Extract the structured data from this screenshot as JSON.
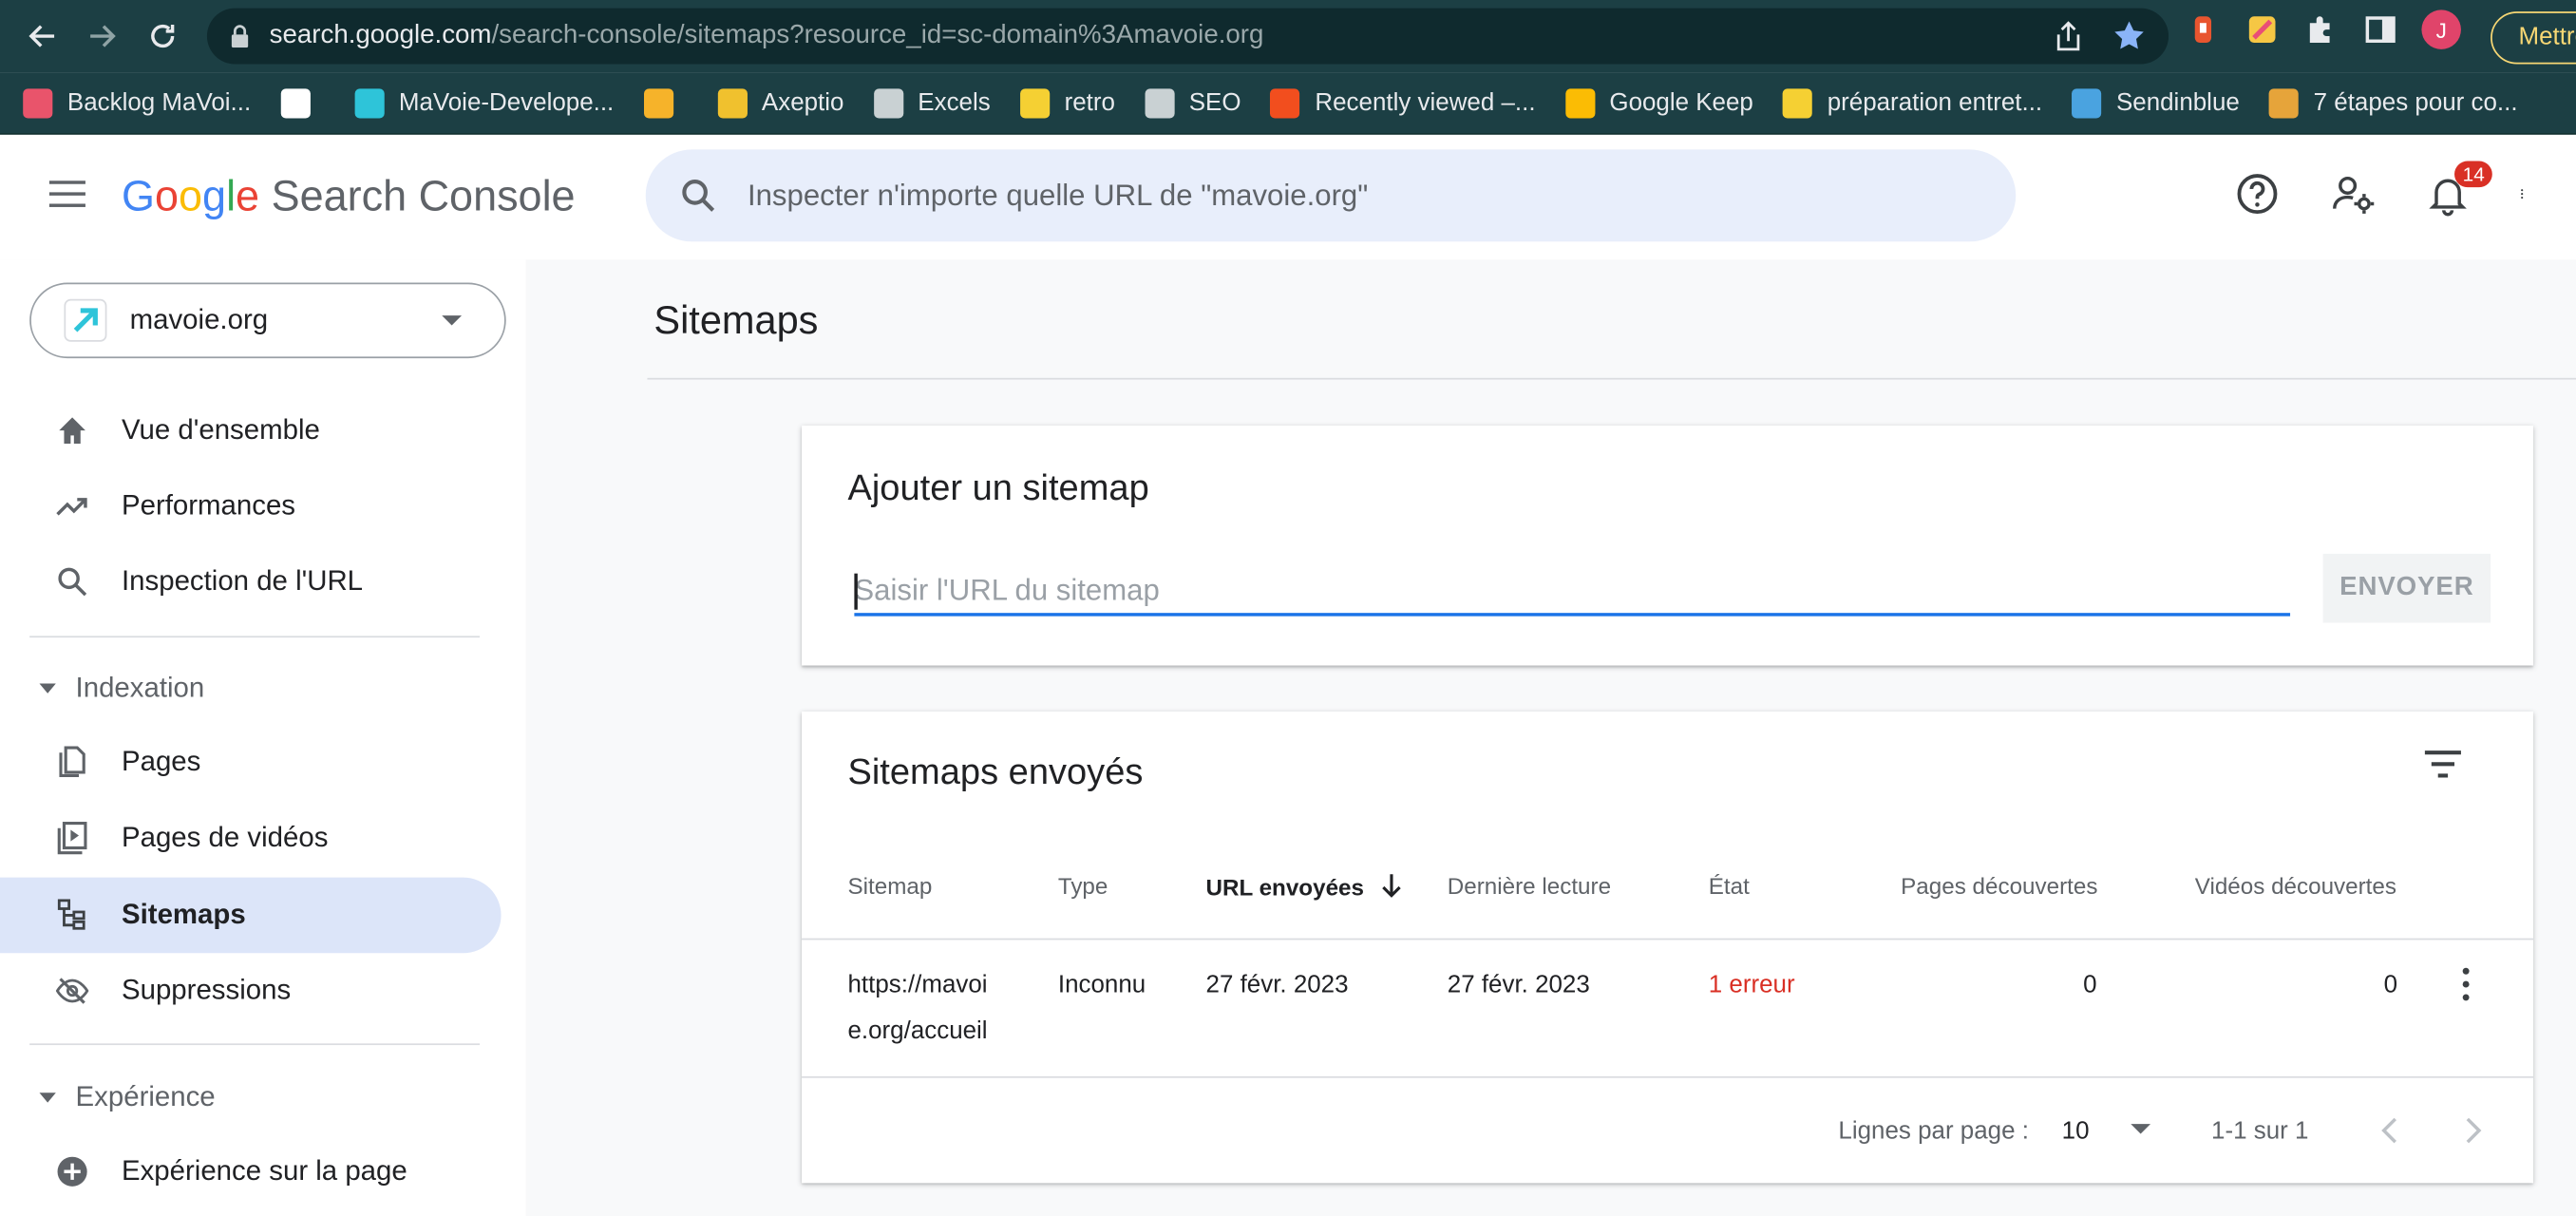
{
  "browser": {
    "url_host": "search.google.com",
    "url_path": "/search-console/sitemaps?resource_id=sc-domain%3Amavoie.org",
    "avatar_letter": "J",
    "update_button": "Mettre",
    "bookmarks": [
      {
        "label": "Backlog MaVoi...",
        "icon": "trello-icon",
        "color": "#e9546b"
      },
      {
        "label": "",
        "icon": "github-icon",
        "color": "#ffffff"
      },
      {
        "label": "MaVoie-Develope...",
        "icon": "arrow-icon",
        "color": "#2ec4d9"
      },
      {
        "label": "",
        "icon": "firebase-icon",
        "color": "#f6b32a"
      },
      {
        "label": "Axeptio",
        "icon": "axeptio-icon",
        "color": "#f0c12e"
      },
      {
        "label": "Excels",
        "icon": "folder-icon",
        "color": "#c9d1d3"
      },
      {
        "label": "retro",
        "icon": "miro-icon",
        "color": "#f5d033"
      },
      {
        "label": "SEO",
        "icon": "folder-icon",
        "color": "#c9d1d3"
      },
      {
        "label": "Recently viewed –...",
        "icon": "figma-icon",
        "color": "#f24e1e"
      },
      {
        "label": "Google Keep",
        "icon": "keep-icon",
        "color": "#fbbc04"
      },
      {
        "label": "préparation entret...",
        "icon": "miro-icon",
        "color": "#f5d033"
      },
      {
        "label": "Sendinblue",
        "icon": "sendinblue-icon",
        "color": "#4aa3e0"
      },
      {
        "label": "7 étapes pour co...",
        "icon": "profile-icon",
        "color": "#e6a43a"
      }
    ]
  },
  "header": {
    "brand_google": [
      "G",
      "o",
      "o",
      "g",
      "l",
      "e"
    ],
    "brand_product": "Search Console",
    "search_placeholder": "Inspecter n'importe quelle URL de \"mavoie.org\"",
    "notification_count": "14"
  },
  "sidebar": {
    "property": "mavoie.org",
    "items_top": [
      {
        "label": "Vue d'ensemble",
        "icon": "home-icon"
      },
      {
        "label": "Performances",
        "icon": "trending-up-icon"
      },
      {
        "label": "Inspection de l'URL",
        "icon": "search-icon"
      }
    ],
    "section_indexation": "Indexation",
    "items_indexation": [
      {
        "label": "Pages",
        "icon": "pages-icon"
      },
      {
        "label": "Pages de vidéos",
        "icon": "video-pages-icon"
      },
      {
        "label": "Sitemaps",
        "icon": "sitemap-icon",
        "active": true
      },
      {
        "label": "Suppressions",
        "icon": "eye-off-icon"
      }
    ],
    "section_experience": "Expérience",
    "items_experience": [
      {
        "label": "Expérience sur la page",
        "icon": "plus-circle-icon"
      }
    ]
  },
  "main": {
    "page_title": "Sitemaps",
    "add_card": {
      "title": "Ajouter un sitemap",
      "input_placeholder": "Saisir l'URL du sitemap",
      "input_value": "",
      "submit_label": "ENVOYER"
    },
    "submitted_card": {
      "title": "Sitemaps envoyés",
      "columns": [
        "Sitemap",
        "Type",
        "URL envoyées",
        "Dernière lecture",
        "État",
        "Pages découvertes",
        "Vidéos découvertes"
      ],
      "sorted_column": "URL envoyées",
      "rows": [
        {
          "sitemap_line1": "https://mavoi",
          "sitemap_line2": "e.org/accueil",
          "type": "Inconnu",
          "submitted": "27 févr. 2023",
          "last_read": "27 févr. 2023",
          "status": "1 erreur",
          "pages": "0",
          "videos": "0"
        }
      ],
      "pagination": {
        "rows_per_page_label": "Lignes par page :",
        "rows_per_page": "10",
        "range": "1-1 sur 1"
      }
    }
  },
  "colors": {
    "accent": "#1a73e8",
    "active_nav": "#dce5f9",
    "error": "#d93025",
    "chrome_bg": "#1c3f44"
  }
}
